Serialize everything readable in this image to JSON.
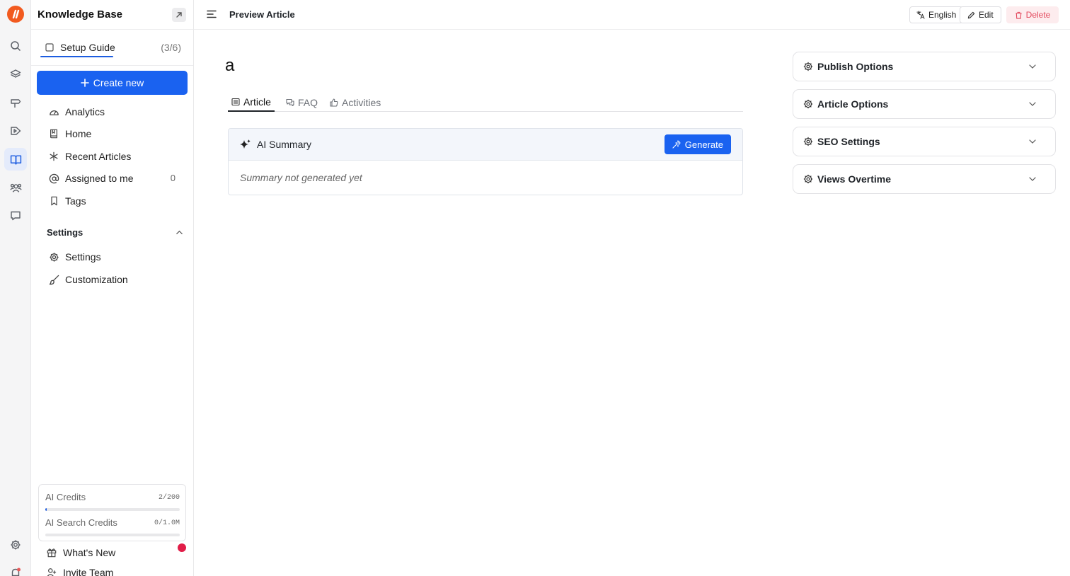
{
  "sidebar": {
    "title": "Knowledge Base",
    "setup": {
      "label": "Setup Guide",
      "count": "(3/6)"
    },
    "create_label": "Create new",
    "nav": [
      {
        "label": "Analytics"
      },
      {
        "label": "Home"
      },
      {
        "label": "Recent Articles"
      },
      {
        "label": "Assigned to me",
        "count": "0"
      },
      {
        "label": "Tags"
      }
    ],
    "settings_section": "Settings",
    "settings_items": [
      {
        "label": "Settings"
      },
      {
        "label": "Customization"
      }
    ],
    "credits": [
      {
        "label": "AI Credits",
        "value": "2/200",
        "fraction": 0.01
      },
      {
        "label": "AI Search Credits",
        "value": "0/1.0M",
        "fraction": 0
      }
    ],
    "whats_new": "What's New",
    "invite": "Invite Team"
  },
  "topbar": {
    "title": "Preview Article",
    "language": "English",
    "edit": "Edit",
    "delete": "Delete"
  },
  "article": {
    "title": "a",
    "tabs": [
      {
        "label": "Article"
      },
      {
        "label": "FAQ"
      },
      {
        "label": "Activities"
      }
    ],
    "ai_summary": {
      "label": "AI Summary",
      "generate": "Generate",
      "empty_text": "Summary not generated yet"
    }
  },
  "options": [
    {
      "label": "Publish Options"
    },
    {
      "label": "Article Options"
    },
    {
      "label": "SEO Settings"
    },
    {
      "label": "Views Overtime"
    }
  ],
  "colors": {
    "primary": "#1a62f0",
    "brand": "#f25a1f",
    "danger": "#e34a5e",
    "notification": "#e11d48"
  }
}
